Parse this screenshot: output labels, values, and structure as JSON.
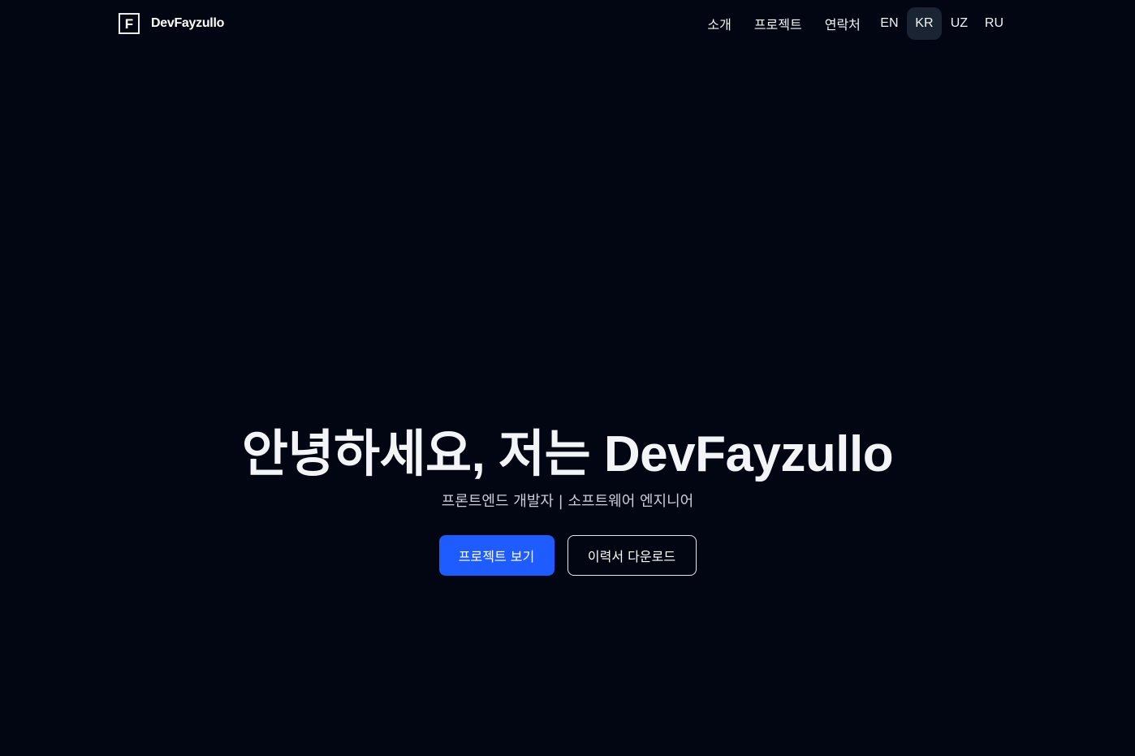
{
  "header": {
    "logo_letter": "F",
    "brand_name": "DevFayzullo",
    "nav": [
      {
        "label": "소개"
      },
      {
        "label": "프로젝트"
      },
      {
        "label": "연락처"
      }
    ],
    "languages": [
      {
        "label": "EN",
        "active": false
      },
      {
        "label": "KR",
        "active": true
      },
      {
        "label": "UZ",
        "active": false
      },
      {
        "label": "RU",
        "active": false
      }
    ]
  },
  "hero": {
    "title": "안녕하세요, 저는 DevFayzullo",
    "subtitle": "프론트엔드 개발자 | 소프트웨어 엔지니어",
    "primary_button": "프로젝트 보기",
    "secondary_button": "이력서 다운로드"
  },
  "colors": {
    "background": "#020613",
    "primary_button": "#1f5cff",
    "active_language_bg": "#1b2433"
  },
  "icons": {
    "logo": "letter-f-box-icon"
  }
}
